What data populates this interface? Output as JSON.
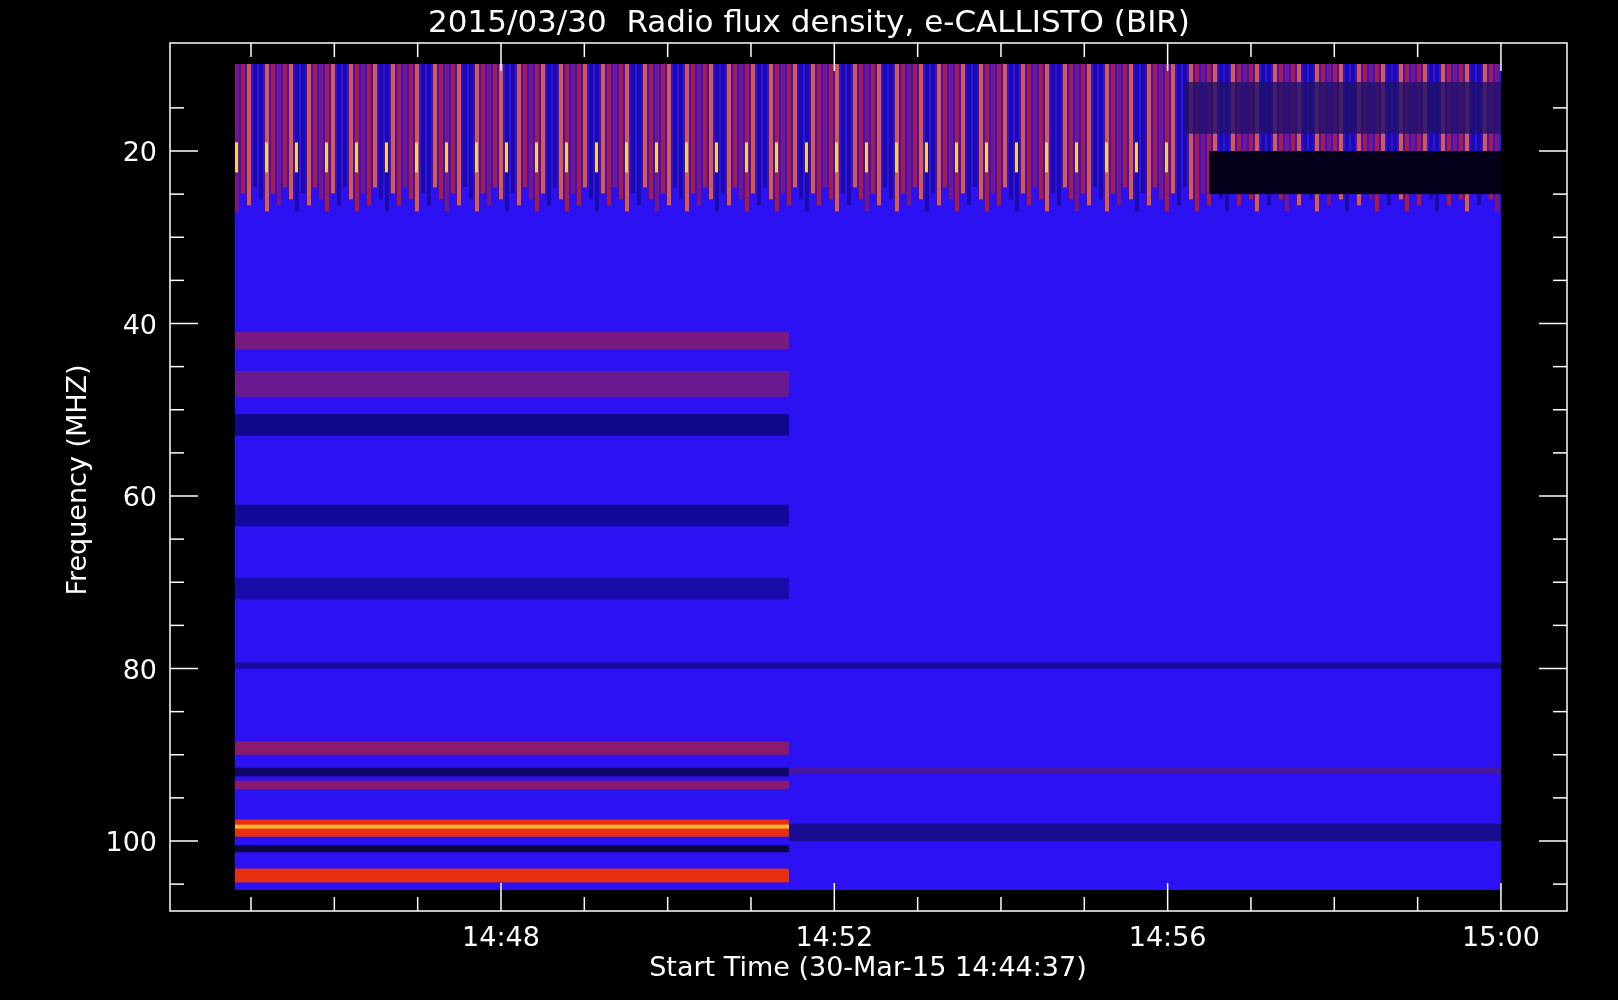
{
  "title": "2015/03/30  Radio flux density, e-CALLISTO (BIR)",
  "y_axis": {
    "label": "Frequency (MHZ)",
    "ticks": [
      "20",
      "40",
      "60",
      "80",
      "100"
    ]
  },
  "x_axis": {
    "label": "Start Time (30-Mar-15 14:44:37)",
    "ticks": [
      "14:48",
      "14:52",
      "14:56",
      "15:00"
    ]
  }
}
